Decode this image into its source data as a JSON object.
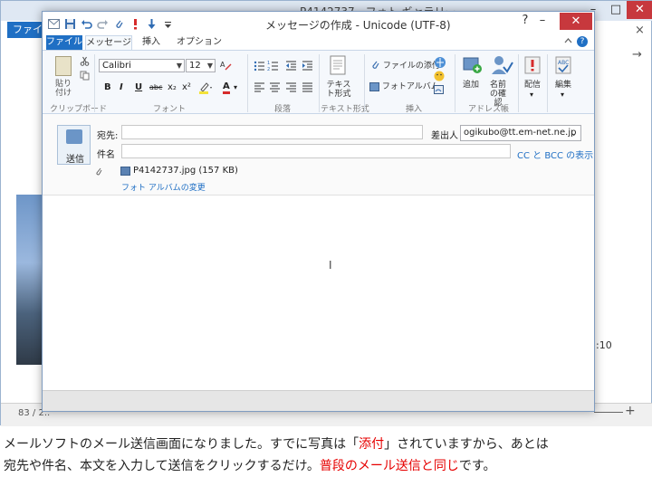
{
  "background_window": {
    "title": "P4142737 - フォト ギャラリー",
    "file_tab": "ファイル",
    "min": "–",
    "max": "□",
    "close": "✕",
    "right_close": "×",
    "right_nav": "→",
    "side_text": ":10",
    "photo_count": "83 / 2..",
    "zoom_plus": "+"
  },
  "mail_window": {
    "title": "メッセージの作成 - Unicode (UTF-8)",
    "controls": {
      "help": "?",
      "min": "–",
      "max": "□",
      "close": "✕"
    },
    "qat_icons": [
      "save-icon",
      "undo-icon",
      "redo-icon",
      "attach-icon",
      "priority-high-icon",
      "priority-low-icon",
      "customize-icon"
    ],
    "tabs": {
      "file": "ファイル",
      "message": "メッセージ",
      "insert": "挿入",
      "option": "オプション"
    },
    "ribbon": {
      "clipboard": {
        "paste_label": "貼り付け",
        "group_label": "クリップボード"
      },
      "font": {
        "font_name": "Calibri",
        "font_size": "12",
        "group_label": "フォント",
        "bold": "B",
        "italic": "I",
        "underline": "U",
        "strike": "abc",
        "sub": "x₂",
        "sup": "x²",
        "color_a": "A"
      },
      "paragraph": {
        "group_label": "段落"
      },
      "text_format": {
        "label": "テキスト形式",
        "group_label": "テキスト形式"
      },
      "insert": {
        "attach_file": "ファイルの添付",
        "photo_album": "フォトアルバム",
        "group_label": "挿入"
      },
      "address_book": {
        "add_label": "追加",
        "check_names_label": "名前の確認",
        "group_label": "アドレス帳"
      },
      "delivery": {
        "label": "配信"
      },
      "edit": {
        "label": "編集"
      }
    },
    "compose": {
      "send_label": "送信",
      "to_label": "宛先:",
      "to_value": "",
      "subject_label": "件名",
      "subject_value": "",
      "sender_label": "差出人",
      "sender_value": "ogikubo@tt.em-net.ne.jp",
      "ccbcc_link": "CC と BCC の表示",
      "attachment": "P4142737.jpg (157 KB)",
      "photo_album_change": "フォト アルバムの変更"
    }
  },
  "caption": {
    "line1_before": "メールソフトのメール送信画面になりました。すでに写真は「",
    "line1_highlight": "添付",
    "line1_after": "」されていますから、あとは",
    "line2_before": "宛先や件名、本文を入力して送信をクリックするだけ。",
    "line2_highlight": "普段のメール送信と同じ",
    "line2_after": "です。"
  },
  "colors": {
    "accent_blue": "#1f6fc4",
    "close_red": "#c7383d",
    "highlight_red": "#e60000"
  }
}
